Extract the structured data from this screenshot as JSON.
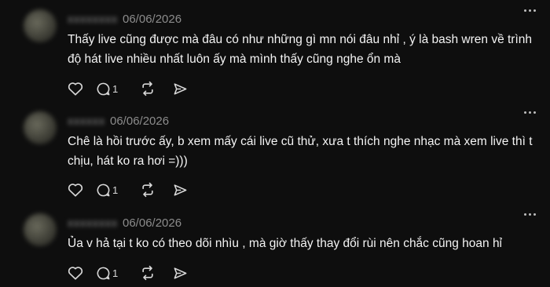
{
  "comments": [
    {
      "username": "xxxxxxxx",
      "date": "06/06/2026",
      "text": "Thấy live cũng được mà đâu có như những gì mn nói đâu nhỉ , ý là bash wren về trình độ hát live nhiều nhất luôn ấy mà mình thấy cũng nghe ổn mà",
      "reply_count": "1"
    },
    {
      "username": "xxxxxx",
      "date": "06/06/2026",
      "text": "Chê là hồi trước ấy, b xem mấy cái live cũ thử, xưa t thích nghe nhạc mà xem live thì t chịu, hát ko ra hơi =)))",
      "reply_count": "1"
    },
    {
      "username": "xxxxxxxx",
      "date": "06/06/2026",
      "text": "Ủa v hả tại t ko có theo dõi nhìu , mà giờ thấy thay đổi rùi nên chắc cũng hoan hỉ",
      "reply_count": "1"
    }
  ],
  "icons": {
    "like": "heart-icon",
    "reply": "comment-bubble-icon",
    "repost": "repost-icon",
    "share": "send-icon",
    "more": "more-dots-icon"
  },
  "colors": {
    "background": "#0e0e0e",
    "text": "#f4f4f4",
    "muted": "#8c8c8c"
  }
}
